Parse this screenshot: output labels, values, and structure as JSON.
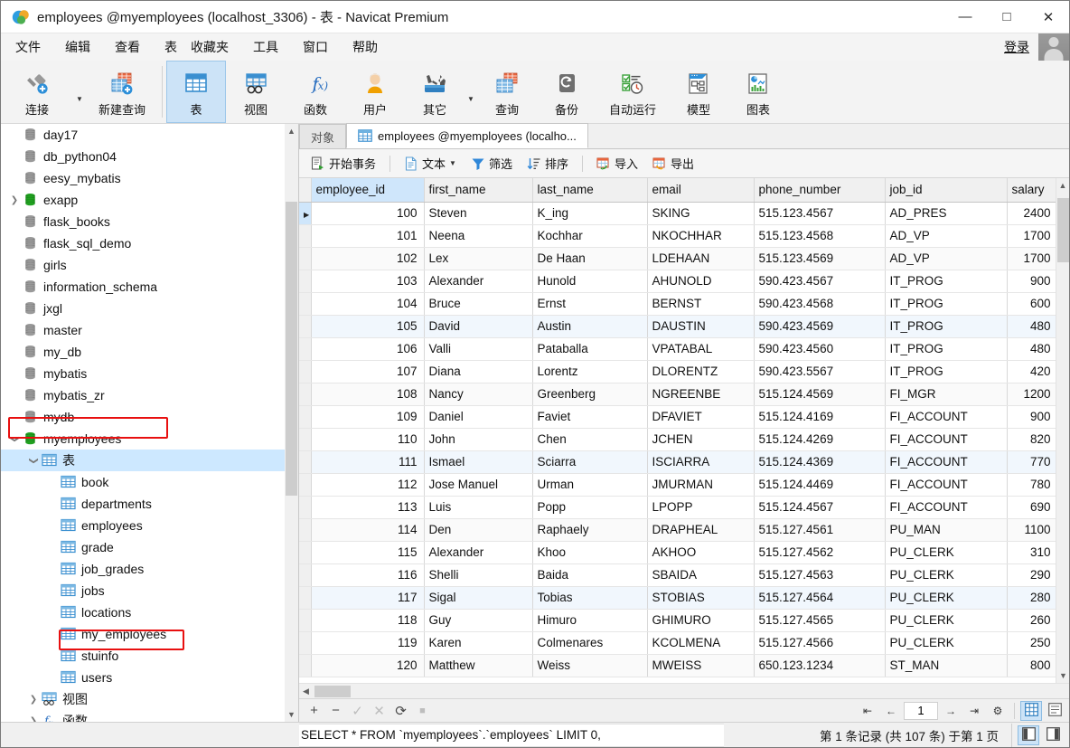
{
  "window": {
    "title": "employees @myemployees (localhost_3306) - 表 - Navicat Premium",
    "minimize": "—",
    "maximize": "□",
    "close": "✕"
  },
  "menubar": {
    "items": [
      "文件",
      "编辑",
      "查看",
      "表",
      "收藏夹",
      "工具",
      "窗口",
      "帮助"
    ],
    "login_label": "登录"
  },
  "toolbar": {
    "buttons": [
      {
        "label": "连接",
        "icon": "connection-icon",
        "caret": true,
        "active": false
      },
      {
        "label": "新建查询",
        "icon": "new-query-icon",
        "caret": false,
        "active": false
      },
      {
        "label": "表",
        "icon": "table-icon",
        "caret": false,
        "active": true
      },
      {
        "label": "视图",
        "icon": "view-icon",
        "caret": false,
        "active": false
      },
      {
        "label": "函数",
        "icon": "function-icon",
        "caret": false,
        "active": false
      },
      {
        "label": "用户",
        "icon": "user-icon",
        "caret": false,
        "active": false
      },
      {
        "label": "其它",
        "icon": "other-tools-icon",
        "caret": true,
        "active": false
      },
      {
        "label": "查询",
        "icon": "query-icon",
        "caret": false,
        "active": false
      },
      {
        "label": "备份",
        "icon": "backup-icon",
        "caret": false,
        "active": false
      },
      {
        "label": "自动运行",
        "icon": "automation-icon",
        "caret": false,
        "active": false
      },
      {
        "label": "模型",
        "icon": "model-icon",
        "caret": false,
        "active": false
      },
      {
        "label": "图表",
        "icon": "chart-icon",
        "caret": false,
        "active": false
      }
    ]
  },
  "sidebar": {
    "nodes": [
      {
        "label": "day17",
        "indent": 1,
        "icon": "database-icon",
        "twist": "",
        "state": "offline"
      },
      {
        "label": "db_python04",
        "indent": 1,
        "icon": "database-icon",
        "twist": "",
        "state": "offline"
      },
      {
        "label": "eesy_mybatis",
        "indent": 1,
        "icon": "database-icon",
        "twist": "",
        "state": "offline"
      },
      {
        "label": "exapp",
        "indent": 1,
        "icon": "database-icon",
        "twist": "right",
        "state": "online"
      },
      {
        "label": "flask_books",
        "indent": 1,
        "icon": "database-icon",
        "twist": "",
        "state": "offline"
      },
      {
        "label": "flask_sql_demo",
        "indent": 1,
        "icon": "database-icon",
        "twist": "",
        "state": "offline"
      },
      {
        "label": "girls",
        "indent": 1,
        "icon": "database-icon",
        "twist": "",
        "state": "offline"
      },
      {
        "label": "information_schema",
        "indent": 1,
        "icon": "database-icon",
        "twist": "",
        "state": "offline"
      },
      {
        "label": "jxgl",
        "indent": 1,
        "icon": "database-icon",
        "twist": "",
        "state": "offline"
      },
      {
        "label": "master",
        "indent": 1,
        "icon": "database-icon",
        "twist": "",
        "state": "offline"
      },
      {
        "label": "my_db",
        "indent": 1,
        "icon": "database-icon",
        "twist": "",
        "state": "offline"
      },
      {
        "label": "mybatis",
        "indent": 1,
        "icon": "database-icon",
        "twist": "",
        "state": "offline"
      },
      {
        "label": "mybatis_zr",
        "indent": 1,
        "icon": "database-icon",
        "twist": "",
        "state": "offline"
      },
      {
        "label": "mydb",
        "indent": 1,
        "icon": "database-icon",
        "twist": "",
        "state": "offline"
      },
      {
        "label": "myemployees",
        "indent": 1,
        "icon": "database-icon",
        "twist": "down",
        "state": "online",
        "highlight": true
      },
      {
        "label": "表",
        "indent": 2,
        "icon": "table-folder-icon",
        "twist": "down",
        "selected": true
      },
      {
        "label": "book",
        "indent": 3,
        "icon": "table-item-icon",
        "twist": ""
      },
      {
        "label": "departments",
        "indent": 3,
        "icon": "table-item-icon",
        "twist": ""
      },
      {
        "label": "employees",
        "indent": 3,
        "icon": "table-item-icon",
        "twist": "",
        "highlight": true
      },
      {
        "label": "grade",
        "indent": 3,
        "icon": "table-item-icon",
        "twist": ""
      },
      {
        "label": "job_grades",
        "indent": 3,
        "icon": "table-item-icon",
        "twist": ""
      },
      {
        "label": "jobs",
        "indent": 3,
        "icon": "table-item-icon",
        "twist": ""
      },
      {
        "label": "locations",
        "indent": 3,
        "icon": "table-item-icon",
        "twist": ""
      },
      {
        "label": "my_employees",
        "indent": 3,
        "icon": "table-item-icon",
        "twist": ""
      },
      {
        "label": "stuinfo",
        "indent": 3,
        "icon": "table-item-icon",
        "twist": ""
      },
      {
        "label": "users",
        "indent": 3,
        "icon": "table-item-icon",
        "twist": ""
      },
      {
        "label": "视图",
        "indent": 2,
        "icon": "view-folder-icon",
        "twist": "right"
      },
      {
        "label": "函数",
        "indent": 2,
        "icon": "function-folder-icon",
        "twist": "right"
      }
    ]
  },
  "tabs": [
    {
      "label": "对象",
      "icon": "",
      "active": false
    },
    {
      "label": "employees @myemployees (localho...",
      "icon": "table-item-icon",
      "active": true
    }
  ],
  "gridtools": [
    {
      "label": "开始事务",
      "icon": "transaction-icon",
      "caret": false
    },
    {
      "label": "文本",
      "icon": "text-icon",
      "caret": true
    },
    {
      "label": "筛选",
      "icon": "filter-icon",
      "caret": false
    },
    {
      "label": "排序",
      "icon": "sort-icon",
      "caret": false
    },
    {
      "label": "导入",
      "icon": "import-icon",
      "caret": false
    },
    {
      "label": "导出",
      "icon": "export-icon",
      "caret": false
    }
  ],
  "grid": {
    "columns": [
      "employee_id",
      "first_name",
      "last_name",
      "email",
      "phone_number",
      "job_id",
      "salary"
    ],
    "selected_column": "employee_id",
    "rows": [
      [
        "100",
        "Steven",
        "K_ing",
        "SKING",
        "515.123.4567",
        "AD_PRES",
        "2400"
      ],
      [
        "101",
        "Neena",
        "Kochhar",
        "NKOCHHAR",
        "515.123.4568",
        "AD_VP",
        "1700"
      ],
      [
        "102",
        "Lex",
        "De Haan",
        "LDEHAAN",
        "515.123.4569",
        "AD_VP",
        "1700"
      ],
      [
        "103",
        "Alexander",
        "Hunold",
        "AHUNOLD",
        "590.423.4567",
        "IT_PROG",
        "900"
      ],
      [
        "104",
        "Bruce",
        "Ernst",
        "BERNST",
        "590.423.4568",
        "IT_PROG",
        "600"
      ],
      [
        "105",
        "David",
        "Austin",
        "DAUSTIN",
        "590.423.4569",
        "IT_PROG",
        "480"
      ],
      [
        "106",
        "Valli",
        "Pataballa",
        "VPATABAL",
        "590.423.4560",
        "IT_PROG",
        "480"
      ],
      [
        "107",
        "Diana",
        "Lorentz",
        "DLORENTZ",
        "590.423.5567",
        "IT_PROG",
        "420"
      ],
      [
        "108",
        "Nancy",
        "Greenberg",
        "NGREENBE",
        "515.124.4569",
        "FI_MGR",
        "1200"
      ],
      [
        "109",
        "Daniel",
        "Faviet",
        "DFAVIET",
        "515.124.4169",
        "FI_ACCOUNT",
        "900"
      ],
      [
        "110",
        "John",
        "Chen",
        "JCHEN",
        "515.124.4269",
        "FI_ACCOUNT",
        "820"
      ],
      [
        "111",
        "Ismael",
        "Sciarra",
        "ISCIARRA",
        "515.124.4369",
        "FI_ACCOUNT",
        "770"
      ],
      [
        "112",
        "Jose Manuel",
        "Urman",
        "JMURMAN",
        "515.124.4469",
        "FI_ACCOUNT",
        "780"
      ],
      [
        "113",
        "Luis",
        "Popp",
        "LPOPP",
        "515.124.4567",
        "FI_ACCOUNT",
        "690"
      ],
      [
        "114",
        "Den",
        "Raphaely",
        "DRAPHEAL",
        "515.127.4561",
        "PU_MAN",
        "1100"
      ],
      [
        "115",
        "Alexander",
        "Khoo",
        "AKHOO",
        "515.127.4562",
        "PU_CLERK",
        "310"
      ],
      [
        "116",
        "Shelli",
        "Baida",
        "SBAIDA",
        "515.127.4563",
        "PU_CLERK",
        "290"
      ],
      [
        "117",
        "Sigal",
        "Tobias",
        "STOBIAS",
        "515.127.4564",
        "PU_CLERK",
        "280"
      ],
      [
        "118",
        "Guy",
        "Himuro",
        "GHIMURO",
        "515.127.4565",
        "PU_CLERK",
        "260"
      ],
      [
        "119",
        "Karen",
        "Colmenares",
        "KCOLMENA",
        "515.127.4566",
        "PU_CLERK",
        "250"
      ],
      [
        "120",
        "Matthew",
        "Weiss",
        "MWEISS",
        "650.123.1234",
        "ST_MAN",
        "800"
      ]
    ]
  },
  "rowbar": {
    "add": "+",
    "remove": "−",
    "apply": "✓",
    "cancel": "✕",
    "refresh": "⟳",
    "stop": "■",
    "first": "⇤",
    "prev": "←",
    "page": "1",
    "next": "→",
    "last": "⇥",
    "settings": "⚙",
    "view_grid": "grid-view-icon",
    "view_form": "form-view-icon"
  },
  "statusbar": {
    "sql": "SELECT * FROM `myemployees`.`employees` LIMIT 0,",
    "record_info": "第 1 条记录 (共 107 条) 于第 1 页",
    "left_panel_toggle": "left-panel-icon",
    "right_panel_toggle": "right-panel-icon"
  },
  "colors": {
    "accent": "#cce3f7",
    "highlight_box": "#e81010",
    "selection": "#cde8ff",
    "db_online": "#21a121",
    "db_offline": "#8e8e8e",
    "table_blue": "#3a8fd0"
  }
}
